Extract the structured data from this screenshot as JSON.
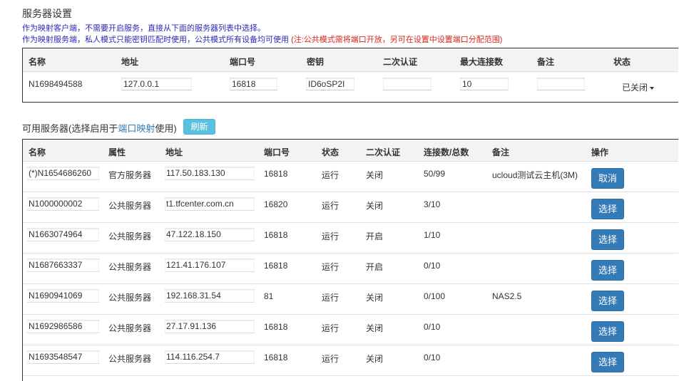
{
  "server_settings": {
    "title": "服务器设置",
    "desc_line1": "作为映射客户端，不需要开启服务，直接从下面的服务器列表中选择。",
    "desc_line2": "作为映射服务端，私人模式只能密钥匹配时使用，公共模式所有设备均可使用",
    "desc_warning": "(注:公共模式需将端口开放，另可在设置中设置端口分配范围)",
    "headers": [
      "名称",
      "地址",
      "端口号",
      "密钥",
      "二次认证",
      "最大连接数",
      "备注",
      "状态"
    ],
    "row": {
      "name": "N1698494588",
      "address": "127.0.0.1",
      "port": "16818",
      "key": "ID6oSP2I",
      "second_auth": "",
      "max_conn": "10",
      "note": "",
      "status": "已关闭"
    }
  },
  "available_servers": {
    "title_prefix": "可用服务器(选择启用于",
    "title_link": "端口映射",
    "title_suffix": "使用)",
    "refresh_label": "刷新",
    "headers": [
      "名称",
      "属性",
      "地址",
      "端口号",
      "状态",
      "二次认证",
      "连接数/总数",
      "备注",
      "操作"
    ],
    "rows": [
      {
        "name": "(*)N1654686260",
        "attr": "官方服务器",
        "address": "117.50.183.130",
        "port": "16818",
        "status": "运行",
        "auth": "关闭",
        "conn": "50/99",
        "note": "ucloud测试云主机(3M)",
        "action": "取消"
      },
      {
        "name": "N1000000002",
        "attr": "公共服务器",
        "address": "t1.tfcenter.com.cn",
        "port": "16820",
        "status": "运行",
        "auth": "关闭",
        "conn": "3/10",
        "note": "",
        "action": "选择"
      },
      {
        "name": "N1663074964",
        "attr": "公共服务器",
        "address": "47.122.18.150",
        "port": "16818",
        "status": "运行",
        "auth": "开启",
        "conn": "1/10",
        "note": "",
        "action": "选择"
      },
      {
        "name": "N1687663337",
        "attr": "公共服务器",
        "address": "121.41.176.107",
        "port": "16818",
        "status": "运行",
        "auth": "开启",
        "conn": "0/10",
        "note": "",
        "action": "选择"
      },
      {
        "name": "N1690941069",
        "attr": "公共服务器",
        "address": "192.168.31.54",
        "port": "81",
        "status": "运行",
        "auth": "关闭",
        "conn": "0/100",
        "note": "NAS2.5",
        "action": "选择"
      },
      {
        "name": "N1692986586",
        "attr": "公共服务器",
        "address": "27.17.91.136",
        "port": "16818",
        "status": "运行",
        "auth": "关闭",
        "conn": "0/10",
        "note": "",
        "action": "选择"
      },
      {
        "name": "N1693548547",
        "attr": "公共服务器",
        "address": "114.116.254.7",
        "port": "16818",
        "status": "运行",
        "auth": "关闭",
        "conn": "0/10",
        "note": "",
        "action": "选择"
      }
    ]
  },
  "colors": {
    "desc_blue": "#2a2ab8",
    "warning_red": "#d9251c",
    "refresh_button": "#5bc0de",
    "action_button": "#337ab7",
    "link": "#337ab7"
  }
}
